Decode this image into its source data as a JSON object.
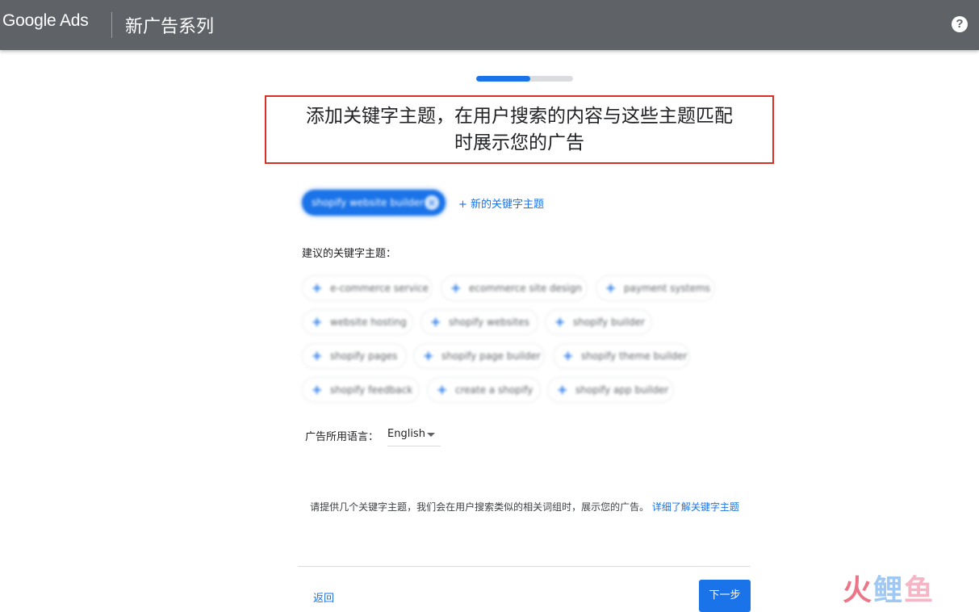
{
  "header": {
    "logo_text": "Google Ads",
    "campaign_title": "新广告系列",
    "help_icon": "?"
  },
  "progress": {
    "fraction": 0.56
  },
  "heading": {
    "line1": "添加关键字主题，在用户搜索的内容与这些主题匹配",
    "line2": "时展示您的广告"
  },
  "selected_topics": [
    {
      "label": "shopify website builder"
    }
  ],
  "add_topic_label": "+ 新的关键字主题",
  "suggestions": {
    "label": "建议的关键字主题：",
    "chips": [
      "e-commerce service",
      "ecommerce site design",
      "payment systems",
      "website hosting",
      "shopify websites",
      "shopify builder",
      "shopify pages",
      "shopify page builder",
      "shopify theme builder",
      "shopify feedback",
      "create a shopify",
      "shopify app builder"
    ]
  },
  "language": {
    "label": "广告所用语言：",
    "value": "English"
  },
  "info": {
    "text": "请提供几个关键字主题，我们会在用户搜索类似的相关词组时，展示您的广告。",
    "link": "详细了解关键字主题"
  },
  "footer": {
    "back_label": "返回",
    "next_label": "下一步"
  },
  "watermark": {
    "c1": "火",
    "c2": "鲤",
    "c3": "鱼"
  },
  "colors": {
    "topbar": "#5f6368",
    "accent": "#1a73e8",
    "highlight_border": "#d93025"
  }
}
